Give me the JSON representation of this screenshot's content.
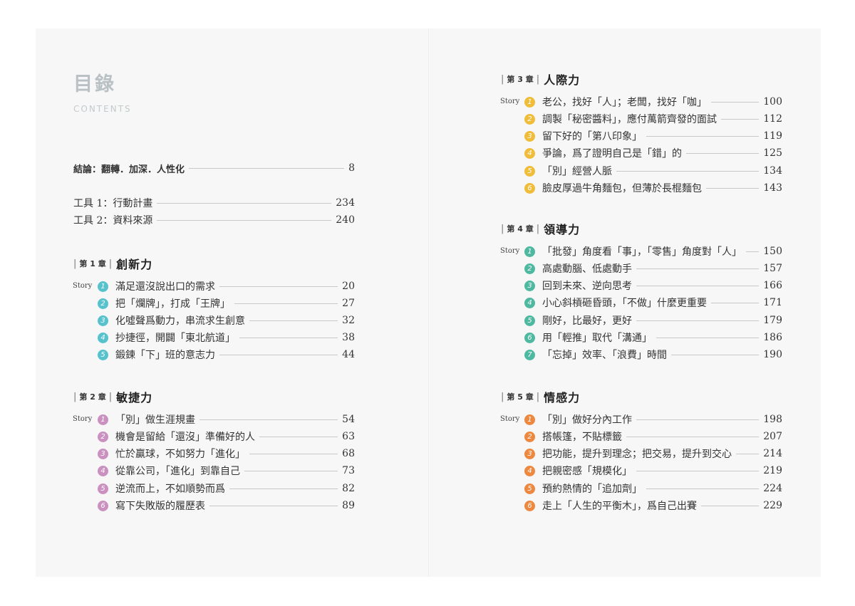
{
  "header": {
    "title": "目錄",
    "subtitle": "CONTENTS"
  },
  "intro": {
    "label": "結論：翻轉．加深．人性化",
    "page": "8"
  },
  "tools": [
    {
      "label": "工具 1：行動計畫",
      "page": "234"
    },
    {
      "label": "工具 2：資料來源",
      "page": "240"
    }
  ],
  "chapters": [
    {
      "label": "第 1 章",
      "name": "創新力",
      "story_label": "Story",
      "color": "#57c2cd",
      "items": [
        {
          "num": "1",
          "text": "滿足還沒說出口的需求",
          "page": "20"
        },
        {
          "num": "2",
          "text": "把「爛牌」，打成「王牌」",
          "page": "27"
        },
        {
          "num": "3",
          "text": "化噓聲爲動力，串流求生創意",
          "page": "32"
        },
        {
          "num": "4",
          "text": "抄捷徑，開闢「東北航道」",
          "page": "38"
        },
        {
          "num": "5",
          "text": "鍛鍊「下」班的意志力",
          "page": "44"
        }
      ]
    },
    {
      "label": "第 2 章",
      "name": "敏捷力",
      "story_label": "Story",
      "color": "#c990c0",
      "items": [
        {
          "num": "1",
          "text": "「別」做生涯規畫",
          "page": "54"
        },
        {
          "num": "2",
          "text": "機會是留給「還沒」準備好的人",
          "page": "63"
        },
        {
          "num": "3",
          "text": "忙於贏球，不如努力「進化」",
          "page": "68"
        },
        {
          "num": "4",
          "text": "從靠公司，「進化」到靠自己",
          "page": "73"
        },
        {
          "num": "5",
          "text": "逆流而上，不如順勢而爲",
          "page": "82"
        },
        {
          "num": "6",
          "text": "寫下失敗版的履歷表",
          "page": "89"
        }
      ]
    },
    {
      "label": "第 3 章",
      "name": "人際力",
      "story_label": "Story",
      "color": "#f0bd3a",
      "items": [
        {
          "num": "1",
          "text": "老公，找好「人」；老闆，找好「咖」",
          "page": "100"
        },
        {
          "num": "2",
          "text": "調製「秘密醬料」，應付萬箭齊發的面試",
          "page": "112"
        },
        {
          "num": "3",
          "text": "留下好的「第八印象」",
          "page": "119"
        },
        {
          "num": "4",
          "text": "爭論，爲了證明自己是「錯」的",
          "page": "125"
        },
        {
          "num": "5",
          "text": "「別」經營人脈",
          "page": "134"
        },
        {
          "num": "6",
          "text": "臉皮厚過牛角麵包，但薄於長棍麵包",
          "page": "143"
        }
      ]
    },
    {
      "label": "第 4 章",
      "name": "領導力",
      "story_label": "Story",
      "color": "#4fb8a0",
      "items": [
        {
          "num": "1",
          "text": "「批發」角度看「事」，「零售」角度對「人」",
          "page": "150"
        },
        {
          "num": "2",
          "text": "高處動腦、低處動手",
          "page": "157"
        },
        {
          "num": "3",
          "text": "回到未來、逆向思考",
          "page": "166"
        },
        {
          "num": "4",
          "text": "小心斜槓砸昏頭，「不做」什麼更重要",
          "page": "171"
        },
        {
          "num": "5",
          "text": "剛好，比最好，更好",
          "page": "179"
        },
        {
          "num": "6",
          "text": "用「輕推」取代「溝通」",
          "page": "186"
        },
        {
          "num": "7",
          "text": "「忘掉」效率、「浪費」時間",
          "page": "190"
        }
      ]
    },
    {
      "label": "第 5 章",
      "name": "情感力",
      "story_label": "Story",
      "color": "#ec8840",
      "items": [
        {
          "num": "1",
          "text": "「別」做好分內工作",
          "page": "198"
        },
        {
          "num": "2",
          "text": "搭帳篷，不貼標籤",
          "page": "207"
        },
        {
          "num": "3",
          "text": "把功能，提升到理念；把交易，提升到交心",
          "page": "214"
        },
        {
          "num": "4",
          "text": "把親密感「規模化」",
          "page": "219"
        },
        {
          "num": "5",
          "text": "預約熱情的「追加劑」",
          "page": "224"
        },
        {
          "num": "6",
          "text": "走上「人生的平衡木」，爲自己出賽",
          "page": "229"
        }
      ]
    }
  ]
}
